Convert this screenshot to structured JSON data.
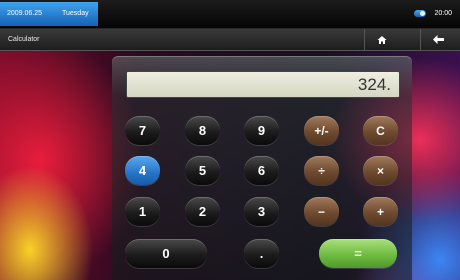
{
  "status_bar": {
    "date": "2009.06.25",
    "day": "Tuesday",
    "time": "20:00"
  },
  "title_bar": {
    "title": "Calculator",
    "home_icon": "home-icon",
    "back_icon": "back-arrow-icon"
  },
  "calculator": {
    "display_value": "324.",
    "rows": [
      [
        "7",
        "8",
        "9",
        "+/-",
        "C"
      ],
      [
        "4",
        "5",
        "6",
        "÷",
        "×"
      ],
      [
        "1",
        "2",
        "3",
        "−",
        "+"
      ],
      [
        "0",
        ".",
        "="
      ]
    ],
    "active_key": "4"
  },
  "colors": {
    "accent_blue": "#2573c9",
    "operator_brown": "#6e4a30",
    "equals_green": "#6ab83e"
  }
}
